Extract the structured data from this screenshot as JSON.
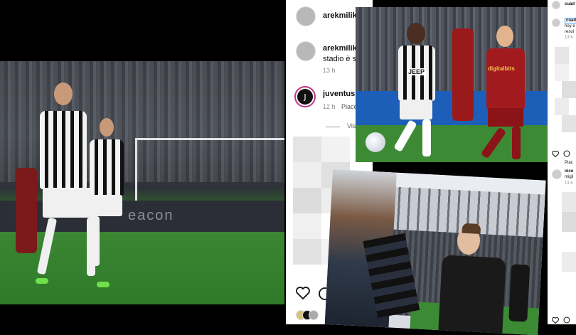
{
  "left_photo": {
    "ad_text": "eacon"
  },
  "panel1": {
    "header_user": "arekmilik",
    "comments": [
      {
        "user": "arekmilik",
        "text": "stadio è stat",
        "time": "13 h"
      },
      {
        "user": "juventus",
        "text": "",
        "time": "12 h",
        "extra": "Piace"
      }
    ],
    "view_replies": "Vis",
    "icons": [
      "heart-icon",
      "comment-icon"
    ]
  },
  "photo2": {
    "sponsor_left": "JEEP",
    "sponsor_right": "digitalbits"
  },
  "panel3": {
    "header_user": "cuad",
    "comment_user": "cuad",
    "comment_lines": [
      "hoy e",
      "resul",
      "13 h"
    ],
    "likes_line": "Piac",
    "reply_user": "nico",
    "reply_text": "migli",
    "reply_time": "13 h"
  },
  "colors": {
    "verified": "#3897f0",
    "juventus_ring": "#c13584"
  }
}
